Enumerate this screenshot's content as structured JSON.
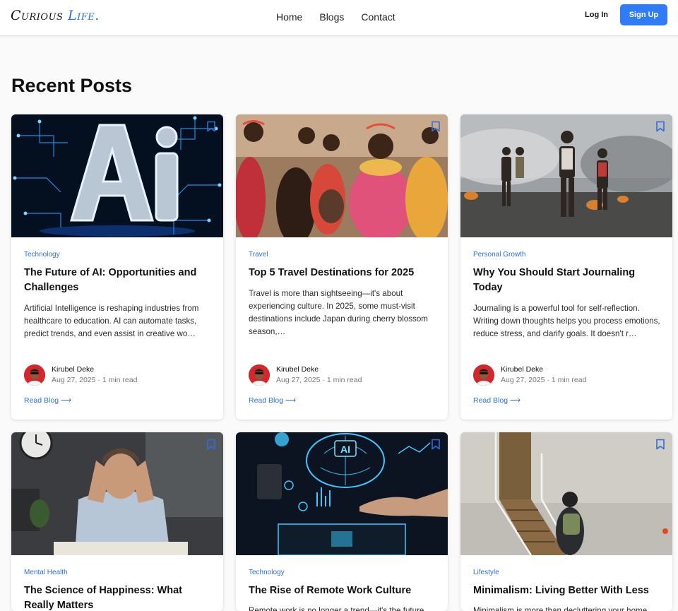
{
  "header": {
    "logo_main": "Curious",
    "logo_accent": "Life.",
    "nav": [
      "Home",
      "Blogs",
      "Contact"
    ],
    "login_label": "Log In",
    "signup_label": "Sign Up"
  },
  "page_title": "Recent Posts",
  "colors": {
    "accent": "#2f7cf6",
    "link": "#2f6ed8"
  },
  "posts": [
    {
      "category": "Technology",
      "title": "The Future of AI: Opportunities and Challenges",
      "excerpt": "Artificial Intelligence is reshaping industries from healthcare to education. AI can automate tasks, predict trends, and even assist in creative wo…",
      "author": "Kirubel Deke",
      "date": "Aug 27, 2025",
      "read_time": "1 min read",
      "read_label": "Read Blog ⟶",
      "image_icon": "ai-circuit-image"
    },
    {
      "category": "Travel",
      "title": "Top 5 Travel Destinations for 2025",
      "excerpt": "Travel is more than sightseeing—it's about experiencing culture. In 2025, some must-visit destinations include Japan during cherry blossom season,…",
      "author": "Kirubel Deke",
      "date": "Aug 27, 2025",
      "read_time": "1 min read",
      "read_label": "Read Blog ⟶",
      "image_icon": "tribal-women-image"
    },
    {
      "category": "Personal Growth",
      "title": "Why You Should Start Journaling Today",
      "excerpt": "Journaling is a powerful tool for self-reflection. Writing down thoughts helps you process emotions, reduce stress, and clarify goals. It doesn't r…",
      "author": "Kirubel Deke",
      "date": "Aug 27, 2025",
      "read_time": "1 min read",
      "read_label": "Read Blog ⟶",
      "image_icon": "smoky-field-image"
    },
    {
      "category": "Mental Health",
      "title": "The Science of Happiness: What Really Matters",
      "excerpt": "",
      "image_icon": "stressed-man-image"
    },
    {
      "category": "Technology",
      "title": "The Rise of Remote Work Culture",
      "excerpt": "Remote work is no longer a trend—it's the future",
      "image_icon": "ai-brain-hand-image"
    },
    {
      "category": "Lifestyle",
      "title": "Minimalism: Living Better With Less",
      "excerpt": "Minimalism is more than decluttering your home",
      "image_icon": "airplane-stairs-image"
    }
  ]
}
